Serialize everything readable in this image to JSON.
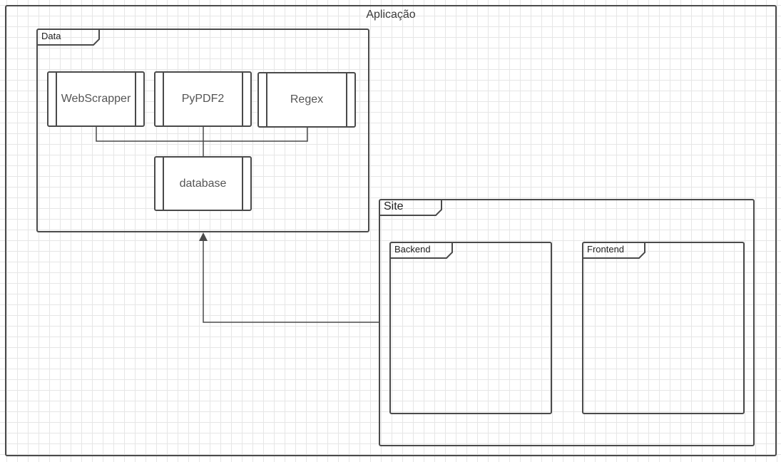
{
  "outer": {
    "title": "Aplicação"
  },
  "data_package": {
    "title": "Data",
    "components": {
      "webscrapper": "WebScrapper",
      "pypdf2": "PyPDF2",
      "regex": "Regex",
      "database": "database"
    }
  },
  "site_package": {
    "title": "Site",
    "backend": "Backend",
    "frontend": "Frontend"
  },
  "colors": {
    "stroke": "#4a4a4a",
    "grid": "#e6e6e6",
    "background": "#ffffff"
  }
}
